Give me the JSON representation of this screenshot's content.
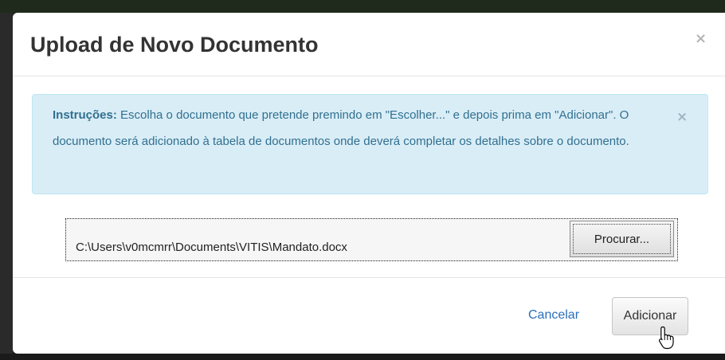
{
  "modal": {
    "title": "Upload de Novo Documento",
    "close_glyph": "×"
  },
  "instructions": {
    "label": "Instruções:",
    "text": " Escolha o documento que pretende premindo em \"Escolher...\" e depois prima em \"Adicionar\". O documento será adicionado à tabela de documentos onde deverá completar os detalhes sobre o documento.",
    "close_glyph": "×"
  },
  "file_input": {
    "value": "C:\\Users\\v0mcmrr\\Documents\\VITIS\\Mandato.docx",
    "browse_label": "Procurar..."
  },
  "footer": {
    "cancel_label": "Cancelar",
    "add_label": "Adicionar"
  },
  "colors": {
    "alert_background": "#d9edf7",
    "alert_text": "#31708f",
    "link": "#2a6ebb"
  },
  "icons": {
    "pointer": "hand-pointer-icon"
  }
}
